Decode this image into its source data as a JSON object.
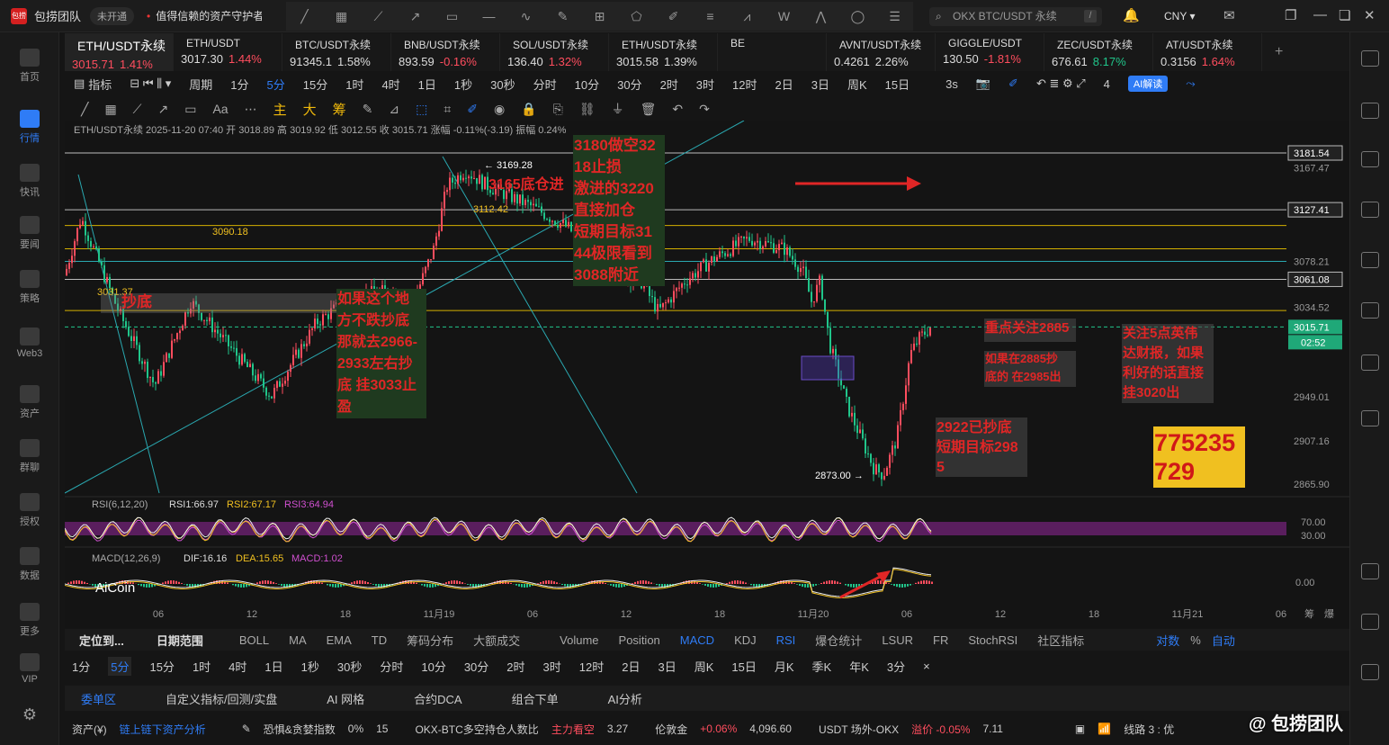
{
  "title_bar": {
    "app_name": "包捞团队",
    "badge": "未开通",
    "notice": "值得信赖的资产守护者",
    "search_placeholder": "OKX BTC/USDT 永续",
    "slash": "/",
    "currency": "CNY"
  },
  "sidebar": [
    {
      "label": "首页",
      "active": false
    },
    {
      "label": "行情",
      "active": true
    },
    {
      "label": "快讯",
      "active": false
    },
    {
      "label": "要闻",
      "active": false
    },
    {
      "label": "策略",
      "active": false
    },
    {
      "label": "Web3",
      "active": false
    },
    {
      "label": "资产",
      "active": false
    },
    {
      "label": "群聊",
      "active": false
    },
    {
      "label": "授权",
      "active": false
    },
    {
      "label": "数据",
      "active": false
    },
    {
      "label": "更多",
      "active": false
    },
    {
      "label": "VIP",
      "active": false
    }
  ],
  "tabs": [
    {
      "name": "ETH/USDT永续",
      "price": "3015.71",
      "change": "1.41%",
      "dir": "up",
      "active": true
    },
    {
      "name": "ETH/USDT",
      "price": "3017.30",
      "change": "1.44%",
      "dir": "up",
      "active": false
    },
    {
      "name": "BTC/USDT永续",
      "price": "91345.1",
      "change": "1.58%",
      "dir": "wt",
      "active": false
    },
    {
      "name": "BNB/USDT永续",
      "price": "893.59",
      "change": "-0.16%",
      "dir": "up",
      "active": false
    },
    {
      "name": "SOL/USDT永续",
      "price": "136.40",
      "change": "1.32%",
      "dir": "up",
      "active": false
    },
    {
      "name": "ETH/USDT永续",
      "price": "3015.58",
      "change": "1.39%",
      "dir": "wt",
      "active": false
    },
    {
      "name": "BE",
      "price": "",
      "change": "",
      "dir": "wt",
      "active": false
    },
    {
      "name": "AVNT/USDT永续",
      "price": "0.4261",
      "change": "2.26%",
      "dir": "wt",
      "active": false
    },
    {
      "name": "GIGGLE/USDT",
      "price": "130.50",
      "change": "-1.81%",
      "dir": "up",
      "active": false
    },
    {
      "name": "ZEC/USDT永续",
      "price": "676.61",
      "change": "8.17%",
      "dir": "dn",
      "active": false
    },
    {
      "name": "AT/USDT永续",
      "price": "0.3156",
      "change": "1.64%",
      "dir": "up",
      "active": false
    }
  ],
  "timeframe_bar": {
    "indicator_label": "指标",
    "period_label": "周期",
    "items": [
      "1分",
      "5分",
      "15分",
      "1时",
      "4时",
      "1日",
      "1秒",
      "30秒",
      "分时",
      "10分",
      "30分",
      "2时",
      "3时",
      "12时",
      "2日",
      "3日",
      "周K",
      "15日"
    ],
    "selected": "5分",
    "refresh": "3s",
    "count": "4",
    "ai_button": "AI解读"
  },
  "toolrow": {
    "text_tool": "Aa",
    "chinese_tools": [
      "主",
      "大",
      "筹"
    ]
  },
  "chart": {
    "info": {
      "symbol": "ETH/USDT永续",
      "datetime": "2025-11-20 07:40",
      "open_label": "开",
      "open": "3018.89",
      "high_label": "高",
      "high": "3019.92",
      "low_label": "低",
      "low": "3012.55",
      "close_label": "收",
      "close": "3015.71",
      "change_label": "涨幅",
      "change": "-0.11%(-3.19)",
      "amp_label": "振幅",
      "amp": "0.24%"
    },
    "price_axis": [
      "3181.54",
      "3167.47",
      "3127.41",
      "3078.21",
      "3061.08",
      "3034.52",
      "3015.71",
      "2949.01",
      "2907.16",
      "2865.90"
    ],
    "countdown": "02:52",
    "time_axis": [
      "06",
      "12",
      "18",
      "11月19",
      "06",
      "12",
      "18",
      "11月20",
      "06",
      "12",
      "18",
      "11月21",
      "06"
    ],
    "labels": {
      "hi_marker": "← 3169.28",
      "lo_marker": "2873.00 →",
      "l3090": "3090.18",
      "l3112": "3112.42",
      "l3031": "3031.37"
    },
    "annotations": {
      "chaodi": "抄底",
      "a1": "3180做空32\n18止损\n激进的3220\n直接加仓\n短期目标31\n44极限看到\n3088附近",
      "a2": "3165底仓进",
      "a3": "如果这个地\n方不跌抄底\n那就去2966-\n2933左右抄\n底 挂3033止\n盈",
      "a4": "重点关注2885",
      "a5": "如果在2885抄\n底的 在2985出",
      "a6": "关注5点英伟\n达财报，如果\n利好的话直接\n挂3020出",
      "a7": "2922已抄底\n短期目标298\n5",
      "a8": "775235\n729"
    },
    "rsi": {
      "label": "RSI(6,12,20)",
      "rsi1": "RSI1:66.97",
      "rsi2": "RSI2:67.17",
      "rsi3": "RSI3:64.94",
      "axis": [
        "70.00",
        "30.00"
      ]
    },
    "macd": {
      "label": "MACD(12,26,9)",
      "dif": "DIF:16.16",
      "dea": "DEA:15.65",
      "macd": "MACD:1.02",
      "axis": [
        "0.00"
      ]
    },
    "aicoin": "AiCoin",
    "corner": [
      "筹",
      "爆"
    ]
  },
  "bottom_indicators": {
    "locate": "定位到...",
    "range": "日期范围",
    "items": [
      "BOLL",
      "MA",
      "EMA",
      "TD",
      "筹码分布",
      "大额成交",
      "Volume",
      "Position",
      "MACD",
      "KDJ",
      "RSI",
      "爆仓统计",
      "LSUR",
      "FR",
      "StochRSI"
    ],
    "active": [
      "MACD",
      "RSI"
    ],
    "community": "社区指标",
    "right": [
      "对数",
      "%",
      "自动"
    ]
  },
  "bottom_timeframes": {
    "items": [
      "1分",
      "5分",
      "15分",
      "1时",
      "4时",
      "1日",
      "1秒",
      "30秒",
      "分时",
      "10分",
      "30分",
      "2时",
      "3时",
      "12时",
      "2日",
      "3日",
      "周K",
      "15日",
      "月K",
      "季K",
      "年K",
      "3分"
    ],
    "selected": "5分",
    "close": "×"
  },
  "bottom_tabs": [
    "委单区",
    "自定义指标/回测/实盘",
    "AI 网格",
    "合约DCA",
    "组合下单",
    "AI分析"
  ],
  "status_bar": {
    "assets": "资产(¥)",
    "chain": "链上链下资产分析",
    "fear_label": "恐惧&贪婪指数",
    "fear_value": "0%",
    "fear_num": "15",
    "ratio_label": "OKX-BTC多空持仓人数比",
    "ratio_tag": "主力看空",
    "ratio_value": "3.27",
    "gold_label": "伦敦金",
    "gold_change": "+0.06%",
    "gold_value": "4,096.60",
    "usdt_label": "USDT 场外-OKX",
    "usdt_premium": "溢价 -0.05%",
    "usdt_value": "7.11",
    "line": "线路 3 : 优"
  },
  "watermark": "@ 包捞团队",
  "colors": {
    "up": "#ff4d5e",
    "down": "#20c58a",
    "accent": "#2f7cf6",
    "annot_red": "#e02626",
    "annot_bg": "#1f3a1f",
    "yellow": "#f0c020",
    "rsi_band": "#5a1e5e"
  }
}
